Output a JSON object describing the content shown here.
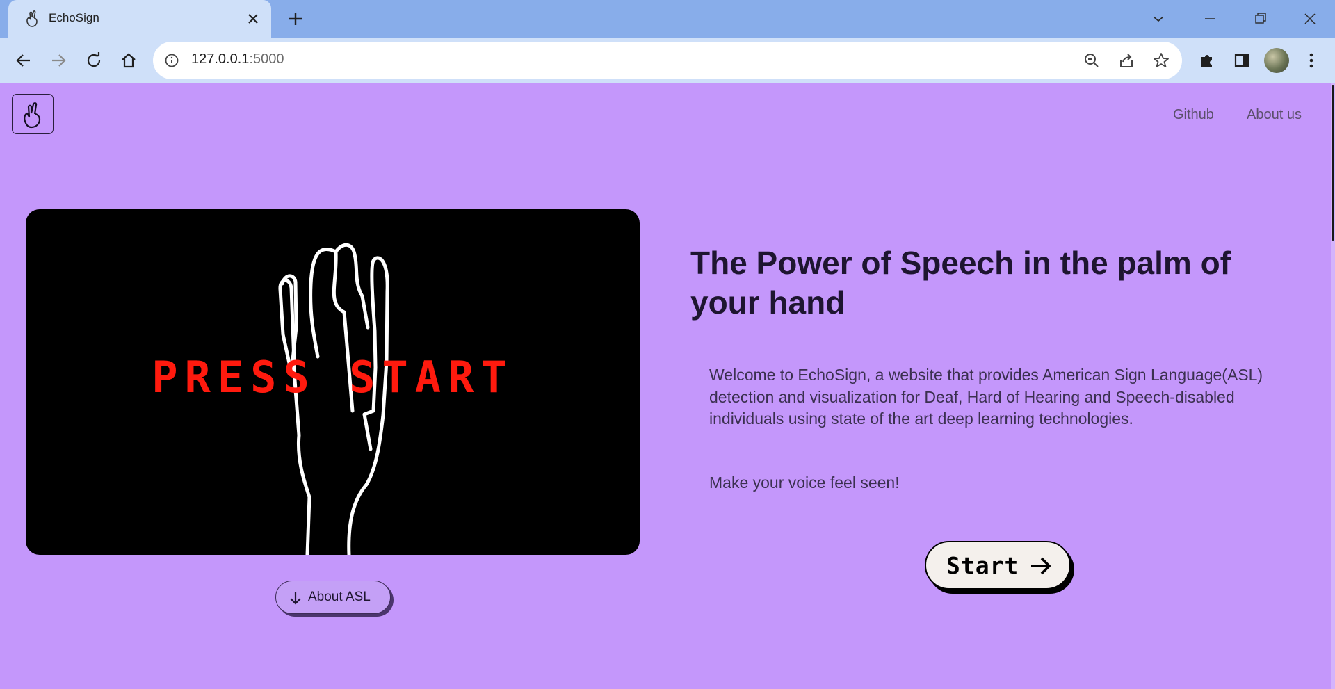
{
  "browser": {
    "tab": {
      "title": "EchoSign",
      "favicon": "hand-heart-icon"
    },
    "address_bar": {
      "host": "127.0.0.1",
      "port": ":5000"
    },
    "colors": {
      "tabstrip": "#88adea",
      "toolbar": "#cfe0f9"
    }
  },
  "site": {
    "nav": {
      "github": "Github",
      "about_us": "About us"
    },
    "logo_icon": "finger-heart-icon",
    "video": {
      "overlay_text": "PRESS START"
    },
    "about_asl_button": "About ASL",
    "headline": "The Power of Speech in the palm of your hand",
    "description": "Welcome to EchoSign, a website that provides American Sign Language(ASL) detection and visualization for Deaf, Hard of Hearing and Speech-disabled individuals using state of the art deep learning technologies.",
    "tagline": "Make your voice feel seen!",
    "start_button": "Start",
    "colors": {
      "background": "#c497fb",
      "press_start_text": "#ff1a0e"
    }
  }
}
